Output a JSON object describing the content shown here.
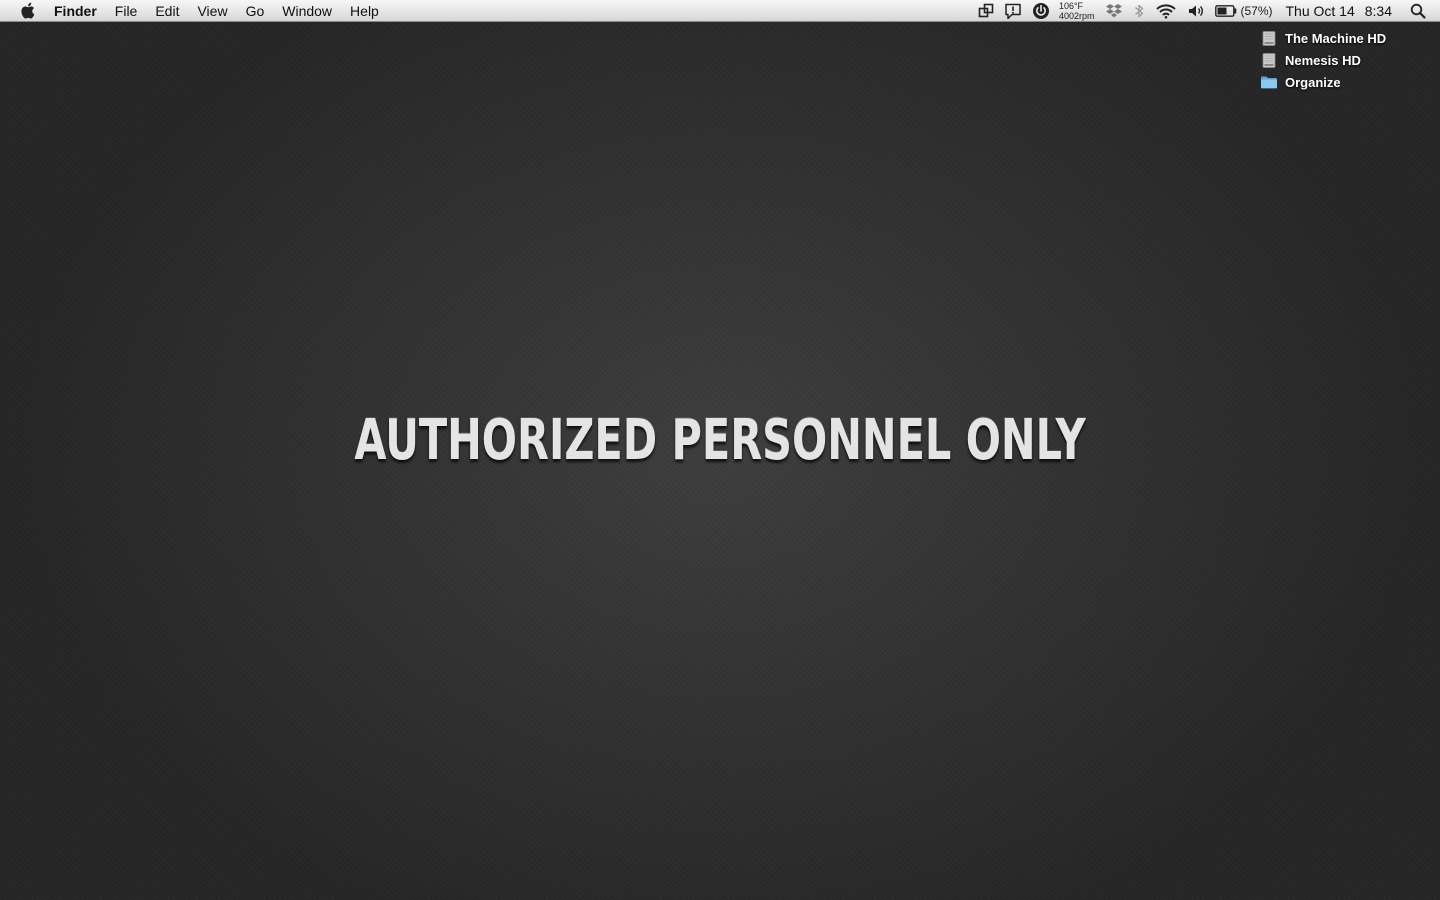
{
  "menubar": {
    "app_name": "Finder",
    "menus": [
      "File",
      "Edit",
      "View",
      "Go",
      "Window",
      "Help"
    ],
    "status": {
      "temperature": "106°F",
      "fan_speed": "4002rpm",
      "battery_percent": "(57%)",
      "day_date": "Thu Oct 14",
      "time": "8:34"
    },
    "icons": [
      "apple-icon",
      "window-arrange-icon",
      "growl-alert-icon",
      "power-icon",
      "dropbox-icon",
      "bluetooth-icon",
      "wifi-icon",
      "volume-icon",
      "battery-icon",
      "spotlight-icon"
    ]
  },
  "desktop": {
    "items": [
      {
        "label": "The Machine HD",
        "icon": "hard-drive-icon"
      },
      {
        "label": "Nemesis HD",
        "icon": "hard-drive-icon"
      },
      {
        "label": "Organize",
        "icon": "folder-icon"
      }
    ],
    "wallpaper_text": "AUTHORIZED PERSONNEL ONLY"
  },
  "colors": {
    "desktop_center": "#3e3e3e",
    "desktop_edge": "#262626",
    "menubar_top": "#f7f7f7",
    "menubar_bottom": "#d6d6d6",
    "folder_blue": "#6fb3e8"
  }
}
